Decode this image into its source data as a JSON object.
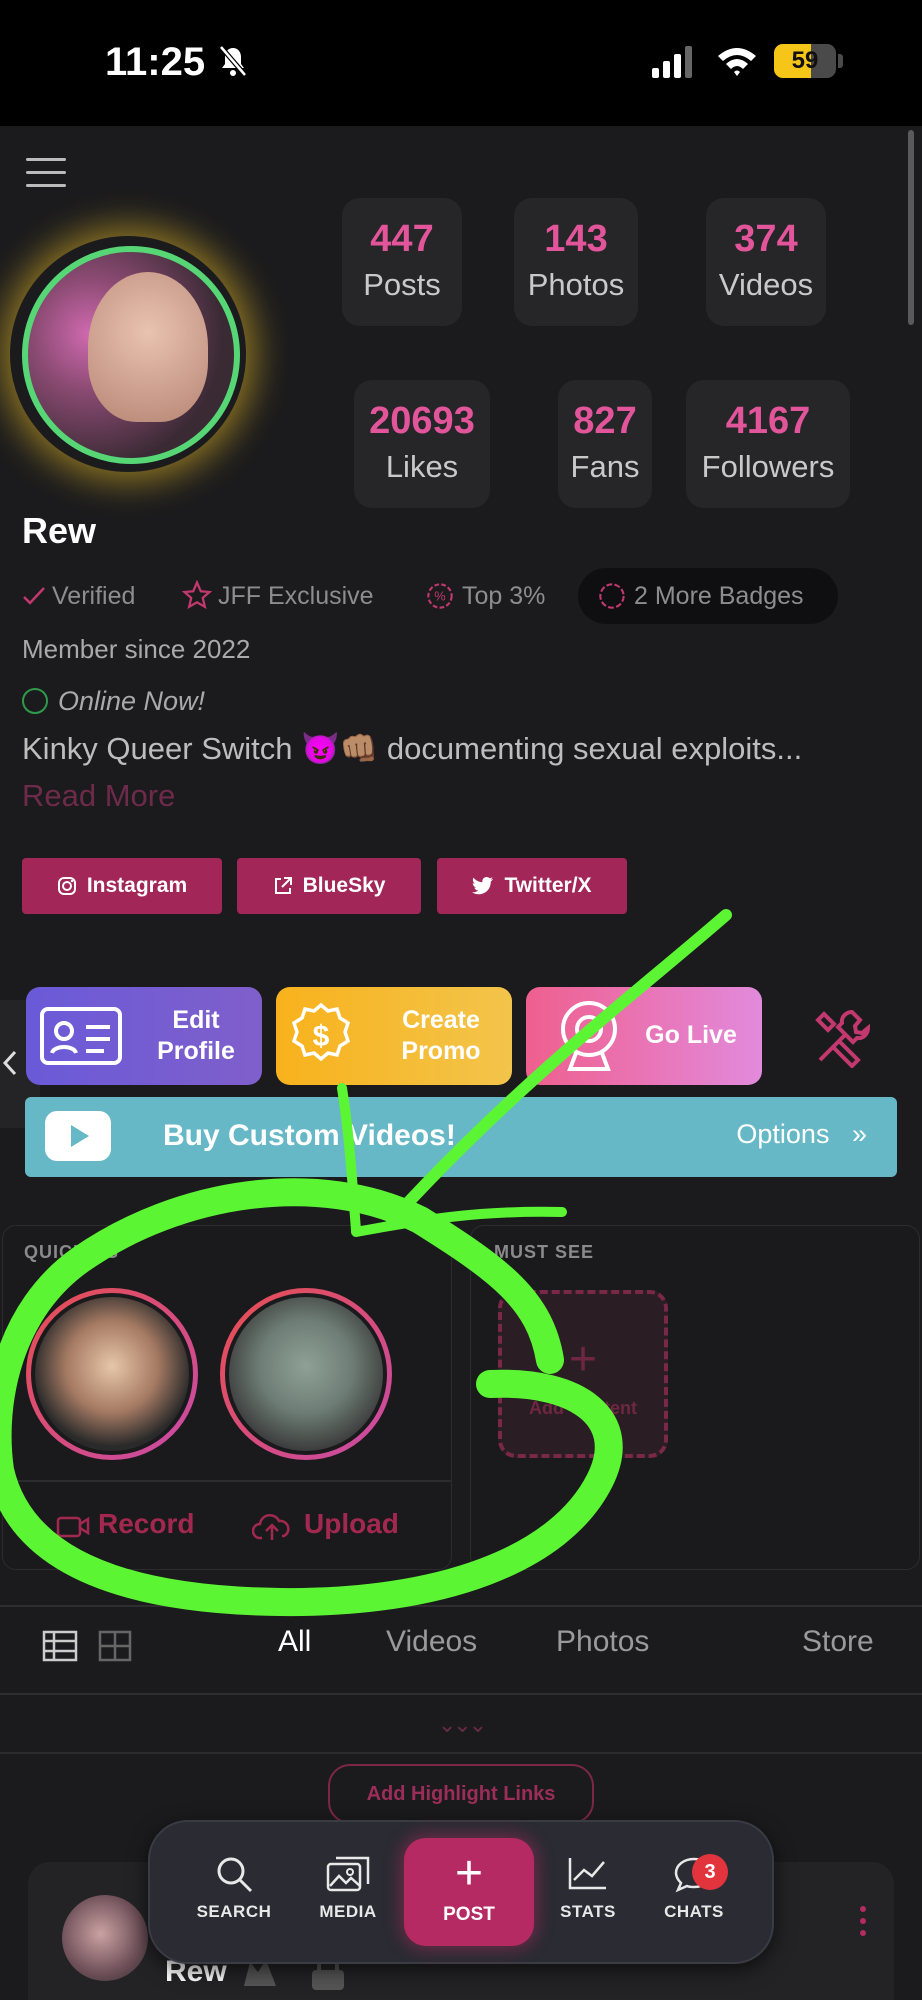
{
  "status_bar": {
    "time": "11:25",
    "battery": "59",
    "battery_level": 0.59
  },
  "profile": {
    "name": "Rew",
    "stats": [
      {
        "value": "447",
        "label": "Posts"
      },
      {
        "value": "143",
        "label": "Photos"
      },
      {
        "value": "374",
        "label": "Videos"
      },
      {
        "value": "20693",
        "label": "Likes"
      },
      {
        "value": "827",
        "label": "Fans"
      },
      {
        "value": "4167",
        "label": "Followers"
      }
    ],
    "badges": [
      "Verified",
      "JFF Exclusive",
      "Top 3%"
    ],
    "more_badges": "2 More Badges",
    "member_since": "Member since 2022",
    "online": "Online Now!",
    "bio": "Kinky Queer Switch 😈👊🏽 documenting sexual exploits...",
    "read_more": "Read More"
  },
  "social_links": [
    "Instagram",
    "BlueSky",
    "Twitter/X"
  ],
  "actions": {
    "edit_profile": "Edit Profile",
    "create_promo": "Create Promo",
    "go_live": "Go Live"
  },
  "custom_video": {
    "label": "Buy Custom Videos!",
    "options": "Options"
  },
  "quickies": {
    "title": "QUICKIES",
    "record": "Record",
    "upload": "Upload"
  },
  "must_see": {
    "title": "MUST SEE",
    "add_label": "Add Content"
  },
  "tabs": {
    "items": [
      "All",
      "Videos",
      "Photos",
      "Store"
    ],
    "active": "All"
  },
  "highlight_button": "Add Highlight Links",
  "post_preview": {
    "author": "Rew"
  },
  "bottom_nav": {
    "search": "SEARCH",
    "media": "MEDIA",
    "post": "POST",
    "stats": "STATS",
    "chats": "CHATS",
    "chats_badge": "3"
  },
  "colors": {
    "accent": "#e2559b",
    "brand": "#a22758",
    "annotation": "#5cf534"
  }
}
